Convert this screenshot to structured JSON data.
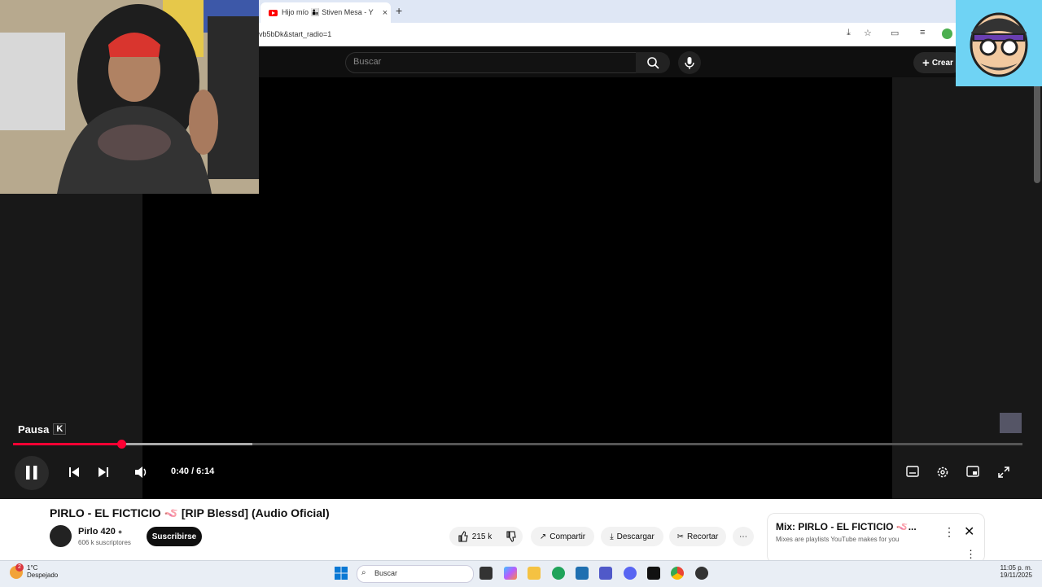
{
  "browser": {
    "tab_title": "Hijo mío 👨‍👦 Stiven Mesa - Y",
    "tab_close": "×",
    "new_tab": "+",
    "url": "vb5bDk&start_radio=1"
  },
  "youtube": {
    "search_placeholder": "Buscar",
    "create_label": "Crear"
  },
  "player": {
    "tooltip": "Pausa",
    "tooltip_key": "K",
    "time": "0:40 / 6:14",
    "progress_fraction": 0.108,
    "buffered_fraction": 0.237
  },
  "video": {
    "title": "PIRLO - EL FICTICIO 🪱 [RIP Blessd] (Audio Oficial)",
    "channel": "Pirlo 420",
    "subscribers": "606 k suscriptores",
    "subscribe_label": "Suscribirse",
    "likes": "215 k",
    "share_label": "Compartir",
    "download_label": "Descargar",
    "clip_label": "Recortar"
  },
  "mix": {
    "title": "Mix: PIRLO - EL FICTICIO 🪱...",
    "subtitle": "Mixes are playlists YouTube makes for you"
  },
  "taskbar": {
    "weather_temp": "1°C",
    "weather_desc": "Despejado",
    "weather_badge": "2",
    "search_label": "Buscar",
    "time": "11:05 p. m.",
    "date": "19/11/2025"
  },
  "colors": {
    "accent": "#ff0033",
    "youtube_red": "#ff0000",
    "logo_bg": "#6fd3f4"
  }
}
